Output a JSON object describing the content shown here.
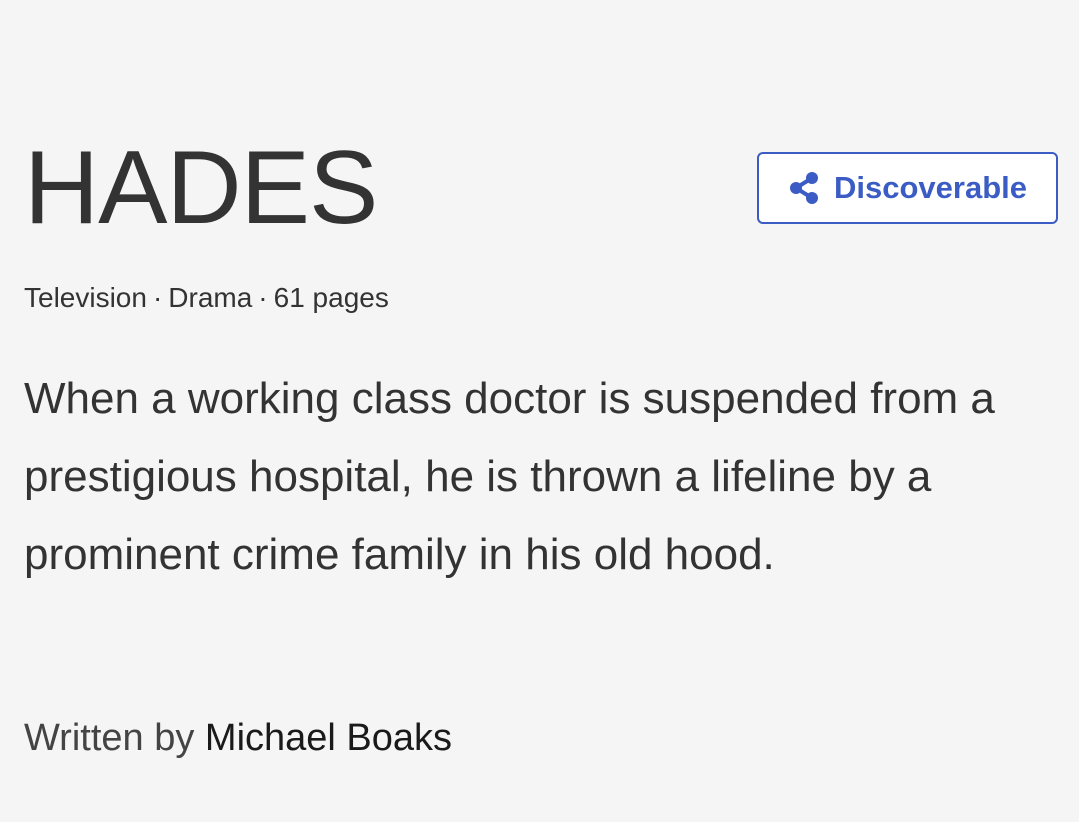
{
  "script": {
    "title": "HADES",
    "format": "Television",
    "genre": "Drama",
    "page_count": "61 pages",
    "separator": "·",
    "logline": "When a working class doctor is suspended from a prestigious hospital, he is thrown a lifeline by a prominent crime family in his old hood.",
    "written_by_label": "Written by",
    "author": "Michael Boaks"
  },
  "actions": {
    "discoverable_label": "Discoverable",
    "discoverable_icon": "share-icon"
  },
  "colors": {
    "background": "#f4f5f4",
    "text": "#333333",
    "accent": "#3a5cc4"
  }
}
